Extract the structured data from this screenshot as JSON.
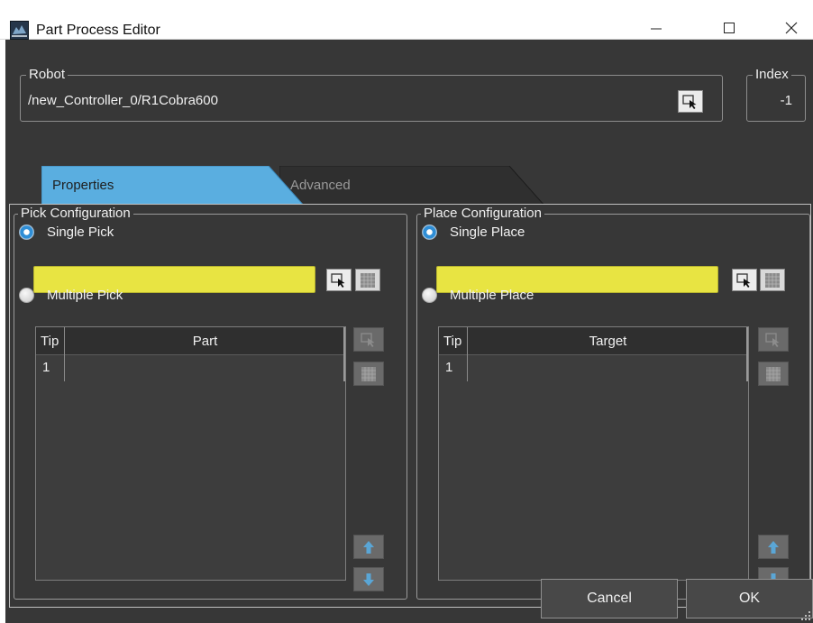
{
  "window": {
    "title": "Part Process Editor",
    "minimize_glyph": "—",
    "maximize_glyph": "☐",
    "close_glyph": "✕"
  },
  "robot": {
    "legend": "Robot",
    "path": "/new_Controller_0/R1Cobra600"
  },
  "index": {
    "legend": "Index",
    "value": "-1"
  },
  "tabs": [
    {
      "label": "Properties",
      "active": true
    },
    {
      "label": "Advanced",
      "active": false
    }
  ],
  "pick": {
    "legend": "Pick Configuration",
    "single_label": "Single Pick",
    "multiple_label": "Multiple Pick",
    "single_selected": true,
    "columns": [
      "Tip",
      "Part"
    ],
    "rows": [
      {
        "tip": "1",
        "value": ""
      }
    ]
  },
  "place": {
    "legend": "Place Configuration",
    "single_label": "Single Place",
    "multiple_label": "Multiple Place",
    "single_selected": true,
    "columns": [
      "Tip",
      "Target"
    ],
    "rows": [
      {
        "tip": "1",
        "value": ""
      }
    ]
  },
  "footer": {
    "cancel_label": "Cancel",
    "ok_label": "OK"
  },
  "colors": {
    "panel_bg": "#373737",
    "tab_active": "#5aaee0",
    "tab_inactive": "#2f2f2f",
    "selection_field": "#e8e442",
    "radio_selected": "#2f8ed6"
  },
  "icons": {
    "app": "part-process-icon",
    "select": "select-arrow-icon",
    "grid": "grid-icon",
    "up": "arrow-up-icon",
    "down": "arrow-down-icon"
  }
}
